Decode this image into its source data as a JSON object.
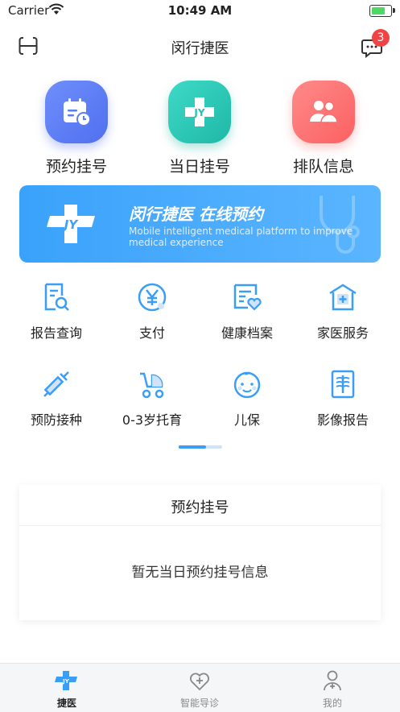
{
  "status_bar": {
    "carrier": "Carrier",
    "time": "10:49 AM"
  },
  "nav": {
    "title": "闵行捷医",
    "message_badge": "3"
  },
  "features": [
    {
      "label": "预约挂号",
      "icon": "calendar-clock-icon",
      "color": "#5b7cf7"
    },
    {
      "label": "当日挂号",
      "icon": "jy-cross-icon",
      "color": "#22c1ae"
    },
    {
      "label": "排队信息",
      "icon": "people-icon",
      "color": "#fc6b6b"
    }
  ],
  "banner": {
    "title": "闵行捷医 在线预约",
    "subtitle": "Mobile intelligent medical platform to improve medical experience"
  },
  "grid": [
    {
      "label": "报告查询",
      "icon": "report-search-icon"
    },
    {
      "label": "支付",
      "icon": "yen-payment-icon"
    },
    {
      "label": "健康档案",
      "icon": "health-record-icon"
    },
    {
      "label": "家医服务",
      "icon": "family-doctor-icon"
    },
    {
      "label": "预防接种",
      "icon": "syringe-icon"
    },
    {
      "label": "0-3岁托育",
      "icon": "stroller-icon"
    },
    {
      "label": "儿保",
      "icon": "baby-face-icon"
    },
    {
      "label": "影像报告",
      "icon": "xray-icon"
    }
  ],
  "card": {
    "title": "预约挂号",
    "empty_text": "暂无当日预约挂号信息"
  },
  "tabbar": [
    {
      "label": "捷医",
      "active": true
    },
    {
      "label": "智能导诊",
      "active": false
    },
    {
      "label": "我的",
      "active": false
    }
  ],
  "colors": {
    "accent": "#3a9ef7",
    "badge": "#ef4444"
  }
}
